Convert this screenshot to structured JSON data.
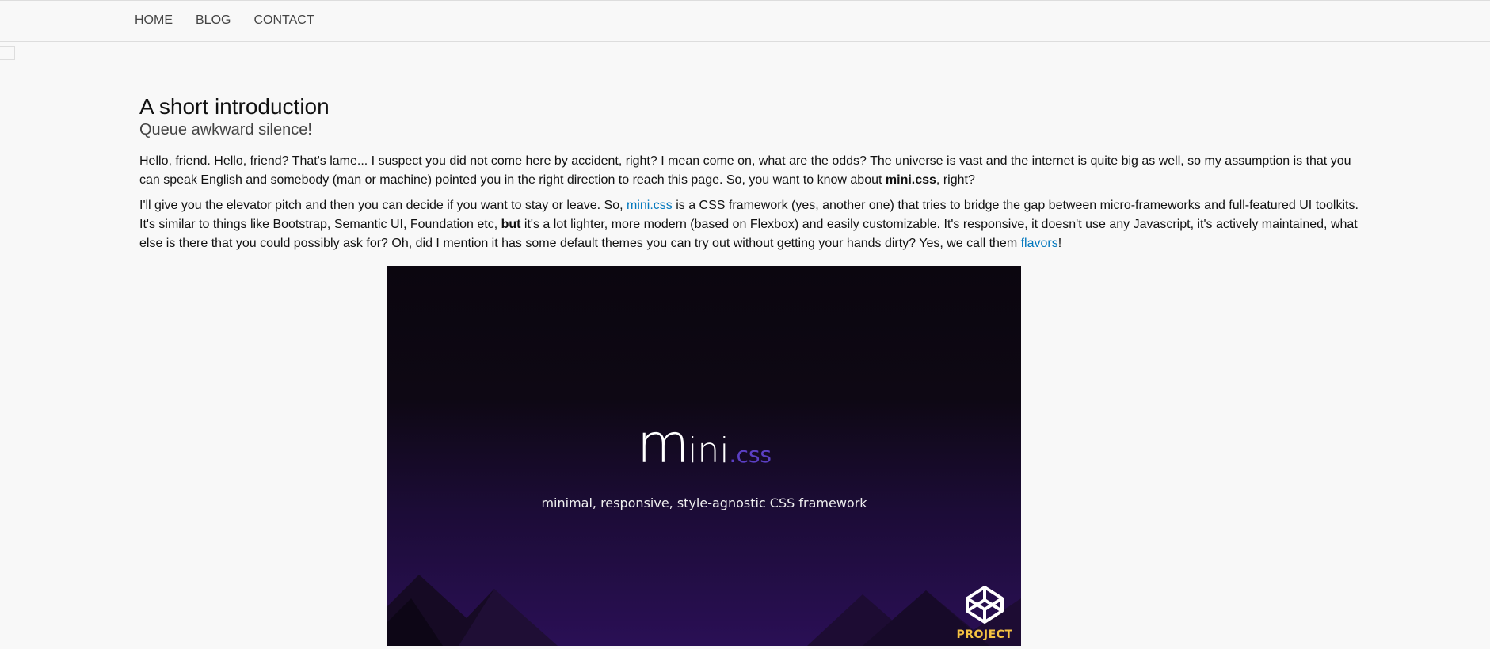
{
  "nav": {
    "items": [
      "HOME",
      "BLOG",
      "CONTACT"
    ]
  },
  "main": {
    "title": "A short introduction",
    "subtitle": "Queue awkward silence!",
    "p1": {
      "text_a": "Hello, friend. Hello, friend? That's lame... I suspect you did not come here by accident, right? I mean come on, what are the odds? The universe is vast and the internet is quite big as well, so my assumption is that you can speak English and somebody (man or machine) pointed you in the right direction to reach this page. So, you want to know about ",
      "bold": "mini.css",
      "text_b": ", right?"
    },
    "p2": {
      "text_a": "I'll give you the elevator pitch and then you can decide if you want to stay or leave. So, ",
      "link1": "mini.css",
      "text_b": " is a CSS framework (yes, another one) that tries to bridge the gap between micro-frameworks and full-featured UI toolkits. It's similar to things like Bootstrap, Semantic UI, Foundation etc, ",
      "bold": "but",
      "text_c": " it's a lot lighter, more modern (based on Flexbox) and easily customizable. It's responsive, it doesn't use any Javascript, it's actively maintained, what else is there that you could possibly ask for? Oh, did I mention it has some default themes you can try out without getting your hands dirty? Yes, we call them ",
      "link2": "flavors",
      "text_d": "!"
    }
  },
  "hero": {
    "logo_m": "m",
    "logo_ini": "ini",
    "logo_css": ".css",
    "tagline": "minimal, responsive, style-agnostic CSS framework",
    "badge_label": "PROJECT",
    "badge_icon": "codepen-icon",
    "colors": {
      "accent": "#5b3fc4",
      "badge": "#f5c242",
      "link": "#0277bd"
    }
  }
}
